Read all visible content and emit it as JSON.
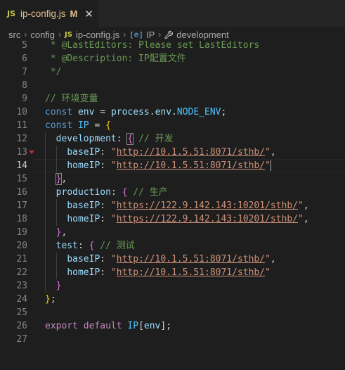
{
  "tab": {
    "icon_text": "JS",
    "filename": "ip-config.js",
    "modified": "M",
    "close": "✕"
  },
  "breadcrumb": {
    "items": [
      "src",
      "config",
      "ip-config.js",
      "IP",
      "development"
    ],
    "js_badge": "JS",
    "var_icon": "[⊘]"
  },
  "editor": {
    "active_line": 14,
    "breakpoint_line": 13,
    "lines": [
      {
        "n": 5,
        "tokens": [
          [
            "c",
            " * @LastEditors: Please set LastEditors"
          ]
        ]
      },
      {
        "n": 6,
        "tokens": [
          [
            "c",
            " * @Description: IP配置文件"
          ]
        ]
      },
      {
        "n": 7,
        "tokens": [
          [
            "c",
            " */"
          ]
        ]
      },
      {
        "n": 8,
        "tokens": []
      },
      {
        "n": 9,
        "tokens": [
          [
            "c",
            "// 环境变量"
          ]
        ]
      },
      {
        "n": 10,
        "tokens": [
          [
            "k",
            "const "
          ],
          [
            "v",
            "env"
          ],
          [
            "p",
            " = "
          ],
          [
            "v",
            "process"
          ],
          [
            "p",
            "."
          ],
          [
            "v",
            "env"
          ],
          [
            "p",
            "."
          ],
          [
            "K",
            "NODE_ENV"
          ],
          [
            "p",
            ";"
          ]
        ]
      },
      {
        "n": 11,
        "tokens": [
          [
            "k",
            "const "
          ],
          [
            "K",
            "IP"
          ],
          [
            "p",
            " = "
          ],
          [
            "b1",
            "{"
          ]
        ]
      },
      {
        "n": 12,
        "tokens": [
          [
            "p",
            "  "
          ],
          [
            "v",
            "development"
          ],
          [
            "p",
            ": "
          ],
          [
            "b2x",
            "{"
          ],
          [
            "p",
            " "
          ],
          [
            "c",
            "// 开发"
          ]
        ]
      },
      {
        "n": 13,
        "tokens": [
          [
            "p",
            "    "
          ],
          [
            "v",
            "baseIP"
          ],
          [
            "p",
            ": "
          ],
          [
            "s",
            "\""
          ],
          [
            "u",
            "http://10.1.5.51:8071/sthb/"
          ],
          [
            "s",
            "\""
          ],
          [
            "p",
            ","
          ]
        ]
      },
      {
        "n": 14,
        "tokens": [
          [
            "p",
            "    "
          ],
          [
            "v",
            "homeIP"
          ],
          [
            "p",
            ": "
          ],
          [
            "s",
            "\""
          ],
          [
            "u",
            "http://10.1.5.51:8071/sthb/"
          ],
          [
            "s",
            "\""
          ],
          [
            "cur",
            ""
          ]
        ]
      },
      {
        "n": 15,
        "tokens": [
          [
            "p",
            "  "
          ],
          [
            "b2x",
            "}"
          ],
          [
            "p",
            ","
          ]
        ]
      },
      {
        "n": 16,
        "tokens": [
          [
            "p",
            "  "
          ],
          [
            "v",
            "production"
          ],
          [
            "p",
            ": "
          ],
          [
            "b2",
            "{"
          ],
          [
            "p",
            " "
          ],
          [
            "c",
            "// 生产"
          ]
        ]
      },
      {
        "n": 17,
        "tokens": [
          [
            "p",
            "    "
          ],
          [
            "v",
            "baseIP"
          ],
          [
            "p",
            ": "
          ],
          [
            "s",
            "\""
          ],
          [
            "u",
            "https://122.9.142.143:10201/sthb/"
          ],
          [
            "s",
            "\""
          ],
          [
            "p",
            ","
          ]
        ]
      },
      {
        "n": 18,
        "tokens": [
          [
            "p",
            "    "
          ],
          [
            "v",
            "homeIP"
          ],
          [
            "p",
            ": "
          ],
          [
            "s",
            "\""
          ],
          [
            "u",
            "https://122.9.142.143:10201/sthb/"
          ],
          [
            "s",
            "\""
          ],
          [
            "p",
            ","
          ]
        ]
      },
      {
        "n": 19,
        "tokens": [
          [
            "p",
            "  "
          ],
          [
            "b2",
            "}"
          ],
          [
            "p",
            ","
          ]
        ]
      },
      {
        "n": 20,
        "tokens": [
          [
            "p",
            "  "
          ],
          [
            "v",
            "test"
          ],
          [
            "p",
            ": "
          ],
          [
            "b2",
            "{"
          ],
          [
            "p",
            " "
          ],
          [
            "c",
            "// 测试"
          ]
        ]
      },
      {
        "n": 21,
        "tokens": [
          [
            "p",
            "    "
          ],
          [
            "v",
            "baseIP"
          ],
          [
            "p",
            ": "
          ],
          [
            "s",
            "\""
          ],
          [
            "u",
            "http://10.1.5.51:8071/sthb/"
          ],
          [
            "s",
            "\""
          ],
          [
            "p",
            ","
          ]
        ]
      },
      {
        "n": 22,
        "tokens": [
          [
            "p",
            "    "
          ],
          [
            "v",
            "homeIP"
          ],
          [
            "p",
            ": "
          ],
          [
            "s",
            "\""
          ],
          [
            "u",
            "http://10.1.5.51:8071/sthb/"
          ],
          [
            "s",
            "\""
          ]
        ]
      },
      {
        "n": 23,
        "tokens": [
          [
            "p",
            "  "
          ],
          [
            "b2",
            "}"
          ]
        ]
      },
      {
        "n": 24,
        "tokens": [
          [
            "b1",
            "}"
          ],
          [
            "p",
            ";"
          ]
        ]
      },
      {
        "n": 25,
        "tokens": []
      },
      {
        "n": 26,
        "tokens": [
          [
            "x",
            "export "
          ],
          [
            "x",
            "default "
          ],
          [
            "K",
            "IP"
          ],
          [
            "p",
            "["
          ],
          [
            "v",
            "env"
          ],
          [
            "p",
            "];"
          ]
        ]
      },
      {
        "n": 27,
        "tokens": []
      }
    ]
  }
}
